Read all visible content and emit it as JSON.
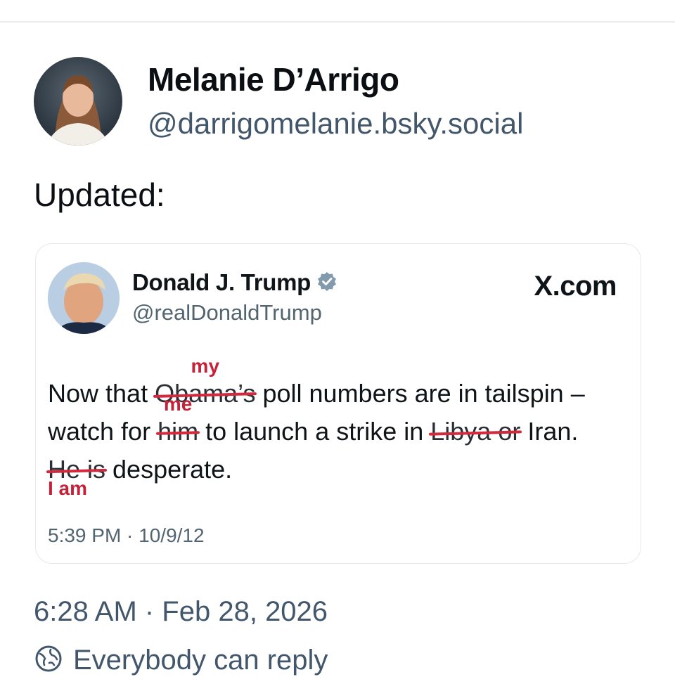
{
  "author": {
    "name": "Melanie D’Arrigo",
    "handle": "@darrigomelanie.bsky.social"
  },
  "post_text": "Updated:",
  "embed": {
    "name": "Donald J. Trump",
    "handle": "@realDonaldTrump",
    "source": "X.com",
    "line1": {
      "a": "Now that ",
      "struck": "Obama’s",
      "repl": "my",
      "b": " poll numbers are in tailspin –"
    },
    "line2": {
      "a": "watch for ",
      "struck1": "him",
      "repl1": "me",
      "b": " to launch a strike in ",
      "struck2": "Libya or",
      "c": " Iran."
    },
    "line3": {
      "struck": "He is",
      "repl": "I am",
      "b": " desperate."
    },
    "time": "5:39 PM · 10/9/12"
  },
  "timestamp": "6:28 AM · Feb 28, 2026",
  "reply_setting": "Everybody can reply",
  "colors": {
    "strike": "#d22a3c",
    "muted": "#42576c",
    "verified": "#829aab"
  }
}
